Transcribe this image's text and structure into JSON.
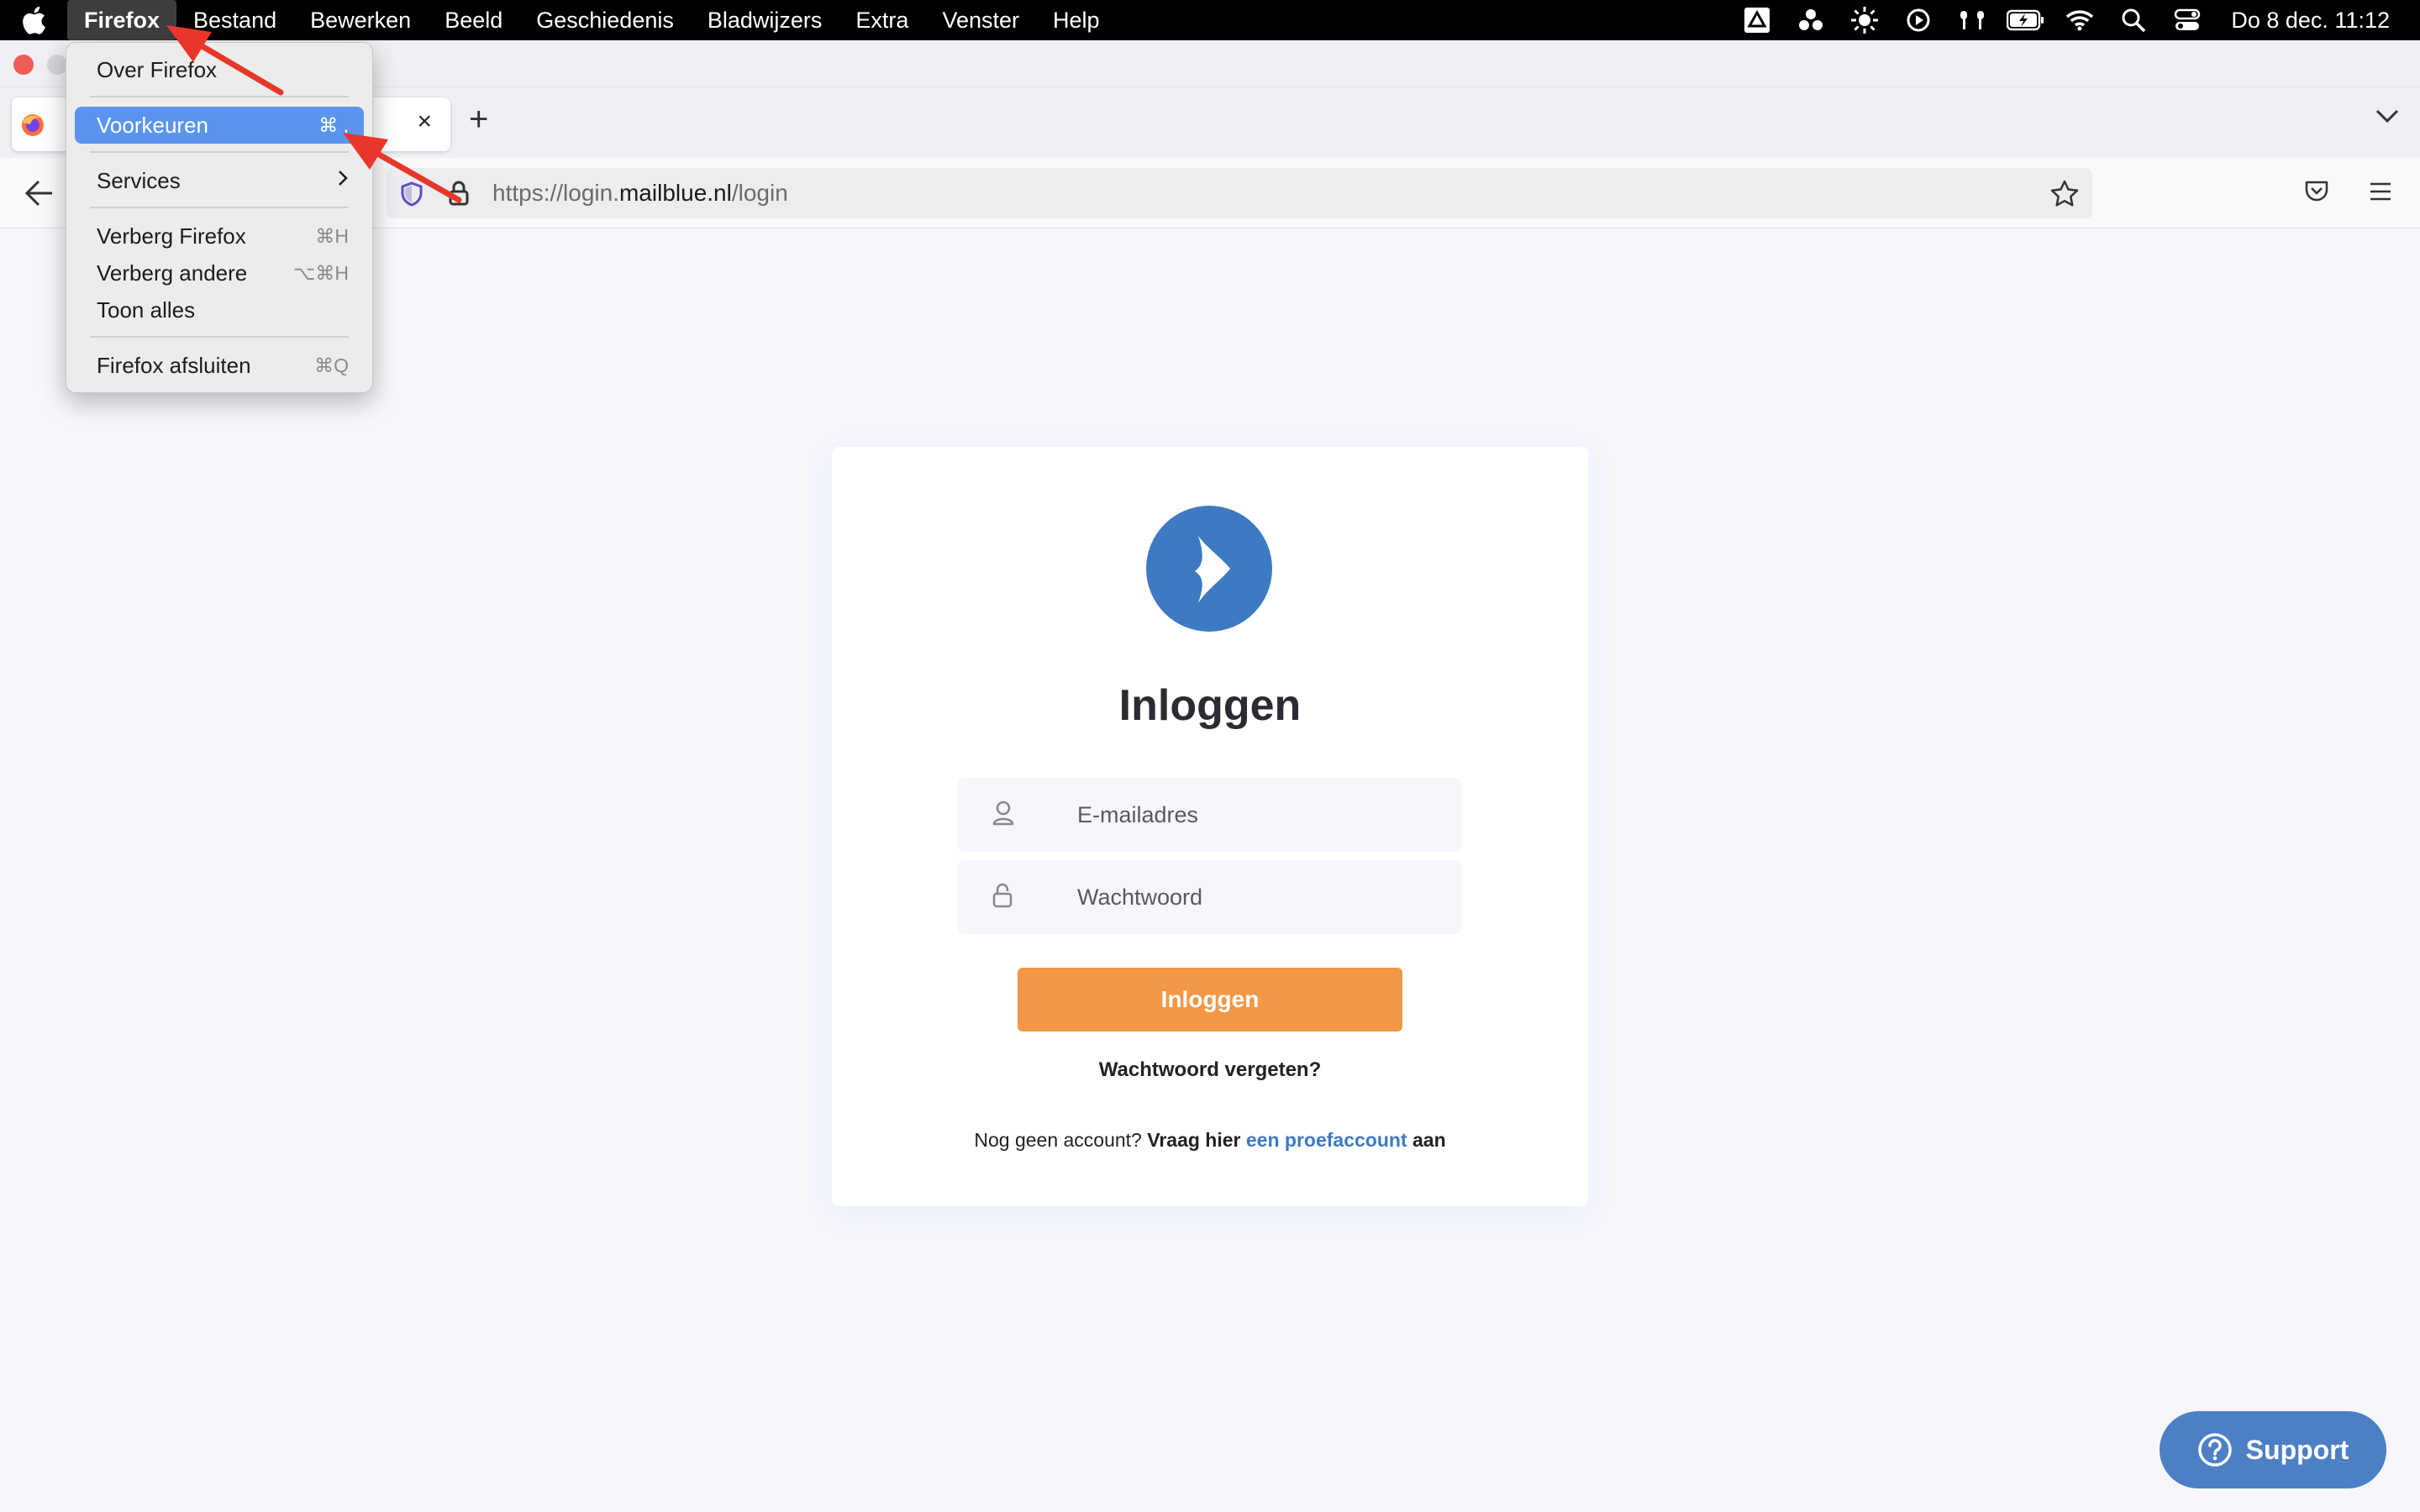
{
  "menubar": {
    "app": "Firefox",
    "items": [
      "Bestand",
      "Bewerken",
      "Beeld",
      "Geschiedenis",
      "Bladwijzers",
      "Extra",
      "Venster",
      "Help"
    ],
    "clock": "Do 8 dec.  11:12",
    "status_icons": [
      "drive-icon",
      "dots-icon",
      "brightness-icon",
      "play-icon",
      "airpods-icon",
      "battery-icon",
      "wifi-icon",
      "spotlight-search-icon",
      "control-center-icon"
    ]
  },
  "firefox_menu": {
    "about": "Over Firefox",
    "preferences": {
      "label": "Voorkeuren",
      "shortcut": "⌘ ,"
    },
    "services": "Services",
    "hide": {
      "label": "Verberg Firefox",
      "shortcut": "⌘H"
    },
    "hide_others": {
      "label": "Verberg andere",
      "shortcut": "⌥⌘H"
    },
    "show_all": "Toon alles",
    "quit": {
      "label": "Firefox afsluiten",
      "shortcut": "⌘Q"
    }
  },
  "tab": {
    "close": "×",
    "new_tab": "+"
  },
  "url": {
    "scheme": "https://login.",
    "host": "mailblue.nl",
    "path": "/login"
  },
  "login": {
    "title": "Inloggen",
    "email_placeholder": "E-mailadres",
    "password_placeholder": "Wachtwoord",
    "button": "Inloggen",
    "forgot": "Wachtwoord vergeten?",
    "signup_prefix": "Nog geen account?",
    "signup_bold1": "Vraag hier",
    "signup_link": "een proefaccount",
    "signup_bold2": "aan"
  },
  "support": {
    "label": "Support"
  },
  "colors": {
    "accent_orange": "#f29846",
    "brand_blue": "#3e7ac2",
    "menu_selected": "#5a94ef",
    "arrow_red": "#e8372a"
  }
}
